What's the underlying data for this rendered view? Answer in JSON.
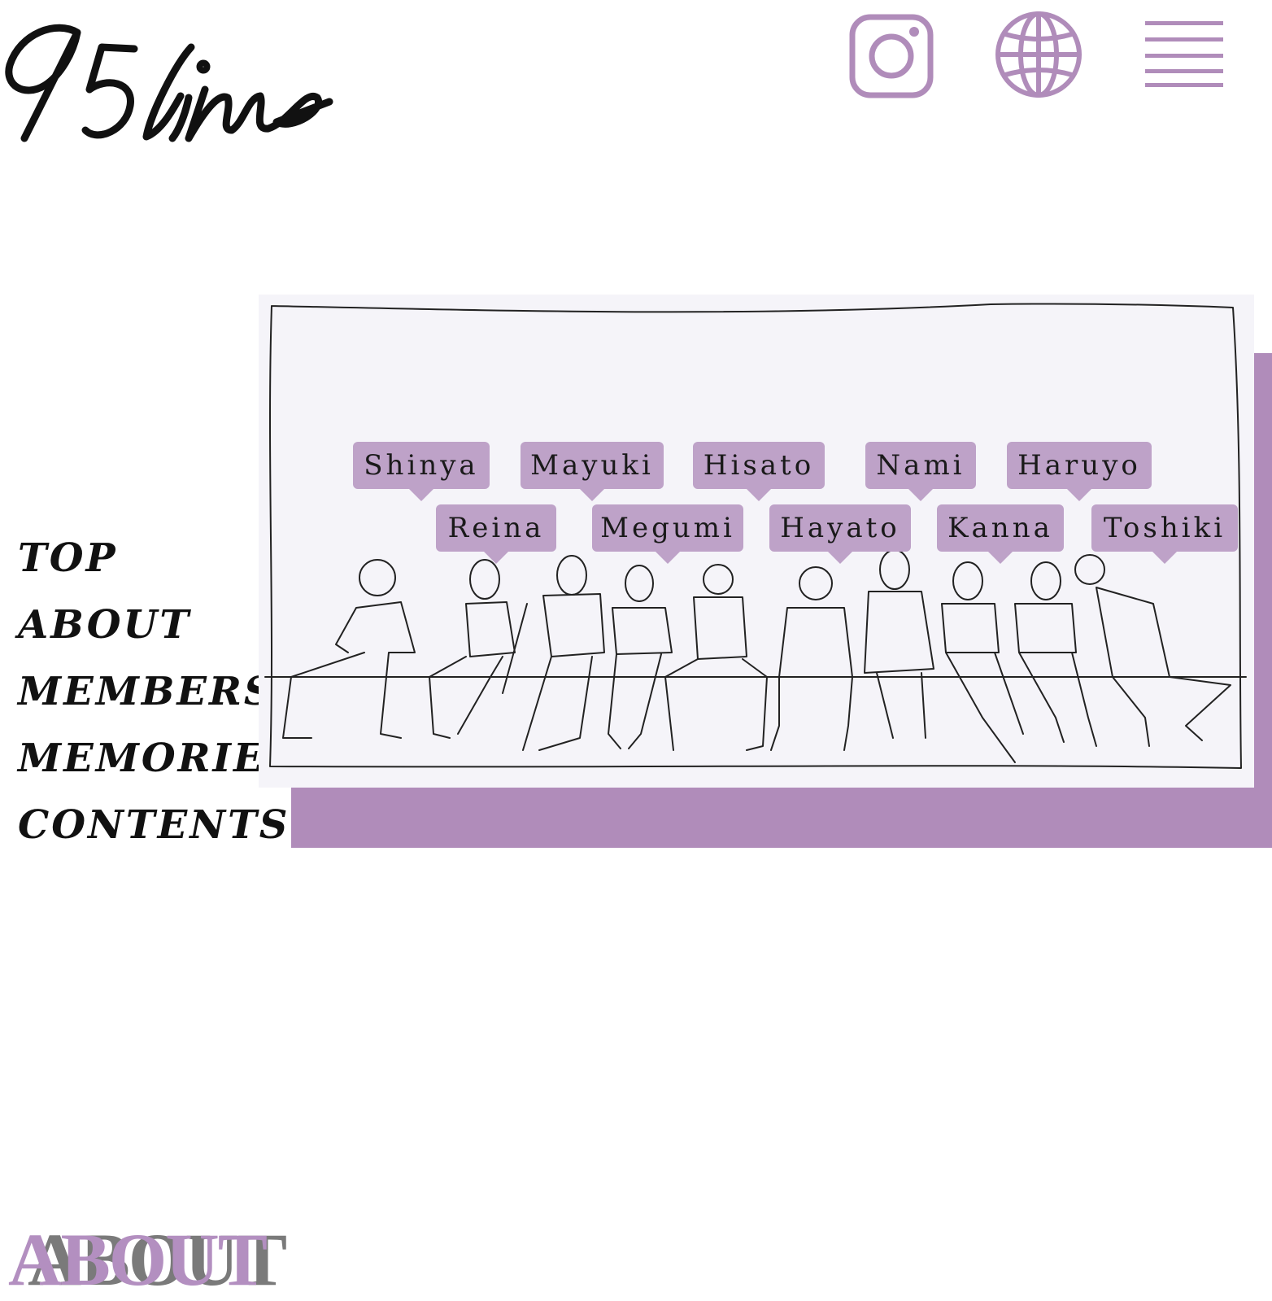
{
  "brand": {
    "logo_text": "95line"
  },
  "header": {
    "icons": [
      {
        "name": "instagram-icon"
      },
      {
        "name": "globe-icon"
      },
      {
        "name": "menu-icon"
      }
    ],
    "accent_color": "#b08cba"
  },
  "nav": {
    "items": [
      {
        "label": "TOP"
      },
      {
        "label": "ABOUT"
      },
      {
        "label": "MEMBERS"
      },
      {
        "label": "MEMORIES"
      },
      {
        "label": "CONTENTS"
      }
    ]
  },
  "members": {
    "top_row": [
      {
        "name": "Shinya"
      },
      {
        "name": "Mayuki"
      },
      {
        "name": "Hisato"
      },
      {
        "name": "Nami"
      },
      {
        "name": "Haruyo"
      }
    ],
    "bottom_row": [
      {
        "name": "Reina"
      },
      {
        "name": "Megumi"
      },
      {
        "name": "Hayato"
      },
      {
        "name": "Kanna"
      },
      {
        "name": "Toshiki"
      }
    ]
  },
  "about": {
    "title": "ABOUT"
  }
}
